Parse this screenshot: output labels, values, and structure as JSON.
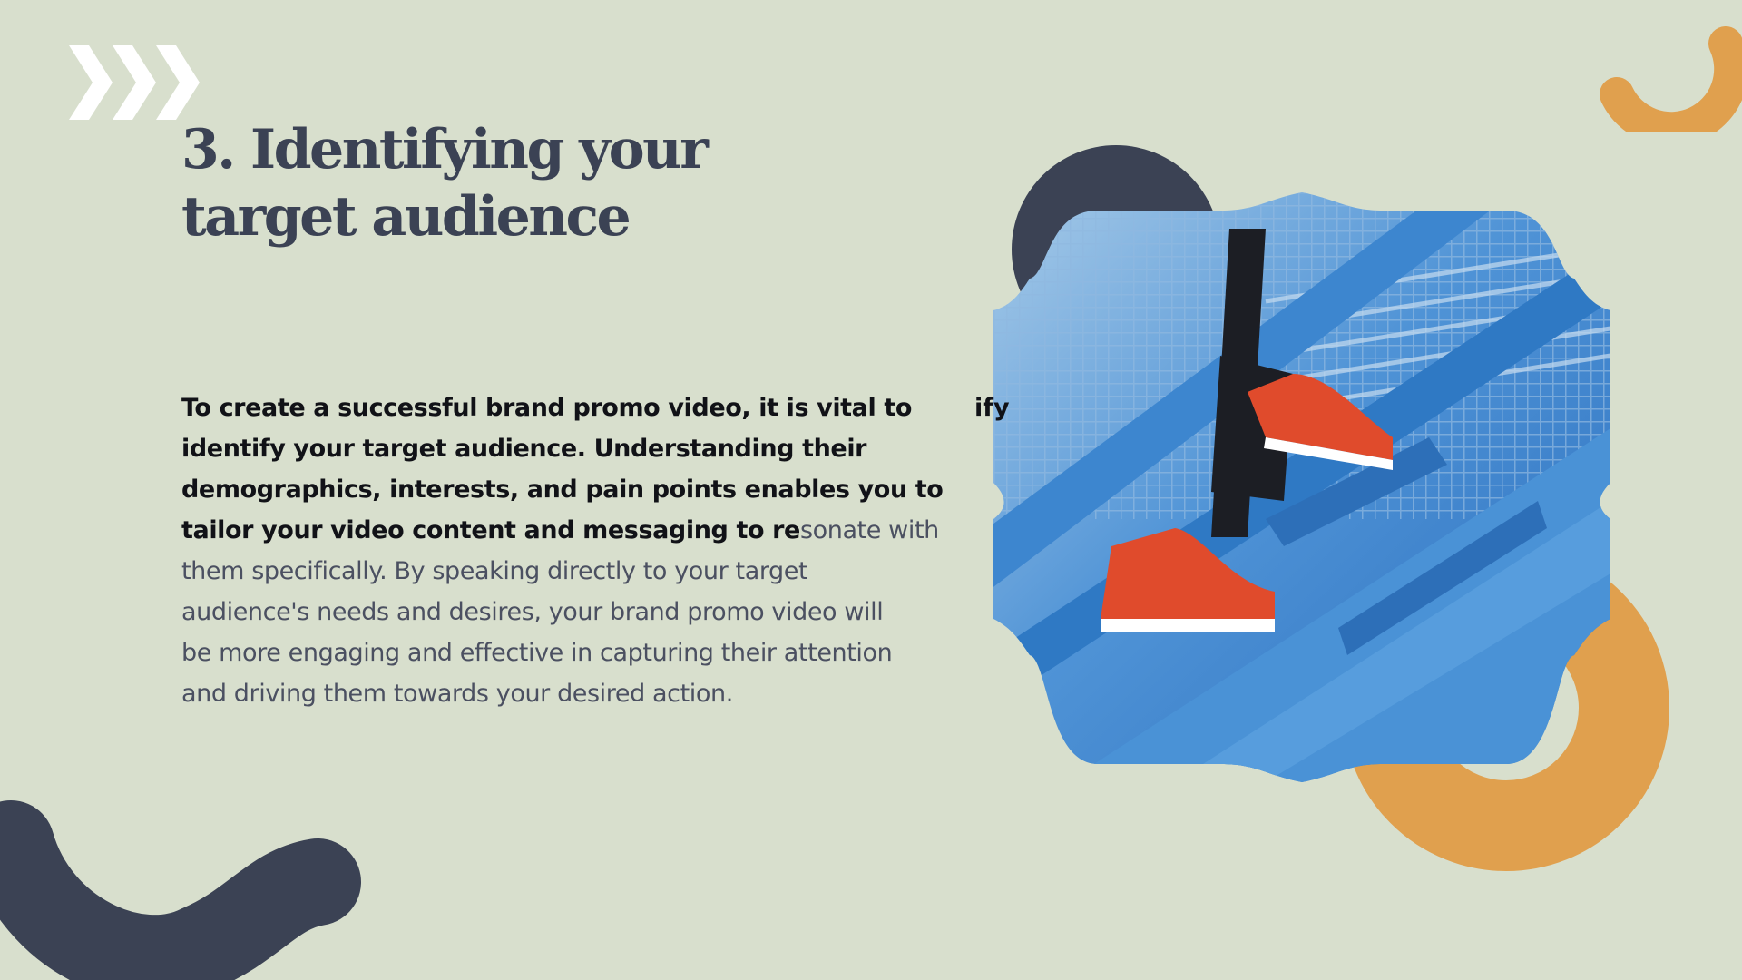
{
  "slide": {
    "title": "3. Identifying your target audience",
    "body_lines": [
      {
        "bold": "To create a successful brand promo video, it is vital to",
        "regular": ""
      },
      {
        "bold": "identify your target audience. Understanding their",
        "regular": ""
      },
      {
        "bold": "demographics, interests, and pain points enables you to",
        "regular": ""
      },
      {
        "bold": "tailor your video content and messaging to re",
        "regular": "sonate with"
      },
      {
        "bold": "",
        "regular": "them specifically. By speaking directly to your target"
      },
      {
        "bold": "",
        "regular": "audience's needs and desires, your brand promo video will"
      },
      {
        "bold": "",
        "regular": "be more engaging and effective in capturing their attention"
      },
      {
        "bold": "",
        "regular": "and driving them towards your desired action."
      }
    ],
    "overflow_fragment": "ify"
  },
  "decorations": {
    "chevron_icon": "chevron-right-icon",
    "photo_subject": "red sneakers climbing blue metal stairs"
  },
  "colors": {
    "background": "#d8dfcd",
    "navy": "#3b4254",
    "orange": "#e0a04e",
    "white": "#ffffff",
    "photo_blue": "#3d86cf"
  }
}
